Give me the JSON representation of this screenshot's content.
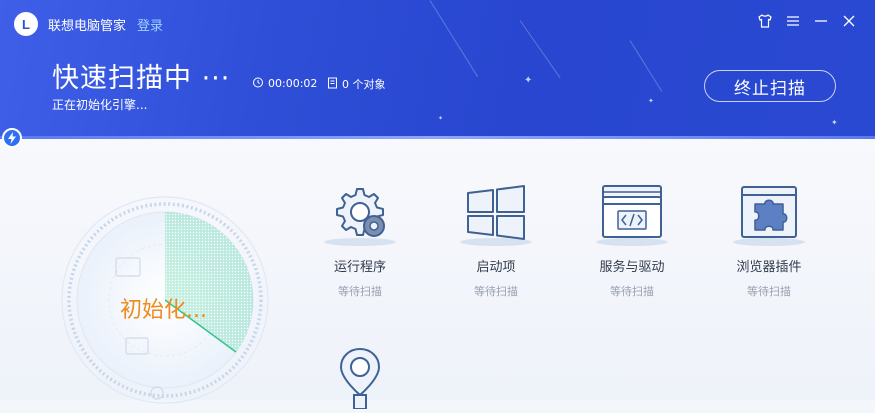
{
  "app": {
    "logo_letter": "L",
    "title": "联想电脑管家",
    "login": "登录"
  },
  "window_controls": [
    "shirt-skin-icon",
    "menu-icon",
    "minimize-icon",
    "close-icon"
  ],
  "scan": {
    "title": "快速扫描中 ···",
    "subtitle": "正在初始化引擎...",
    "elapsed": "00:00:02",
    "objects": "0 个对象",
    "stop_label": "终止扫描",
    "gauge_text": "初始化..."
  },
  "items": [
    {
      "name": "运行程序",
      "status": "等待扫描",
      "icon": "gear-icon"
    },
    {
      "name": "启动项",
      "status": "等待扫描",
      "icon": "windows-icon"
    },
    {
      "name": "服务与驱动",
      "status": "等待扫描",
      "icon": "code-window-icon"
    },
    {
      "name": "浏览器插件",
      "status": "等待扫描",
      "icon": "puzzle-icon"
    },
    {
      "name": "",
      "status": "",
      "icon": "location-pin-icon"
    }
  ],
  "colors": {
    "header": "#2f4fd8",
    "accent": "#2f6ff2",
    "gauge_text": "#f08a1e",
    "icon_stroke": "#3f6193",
    "login": "#9fd2ff",
    "sweep": "#5cd6a8"
  }
}
